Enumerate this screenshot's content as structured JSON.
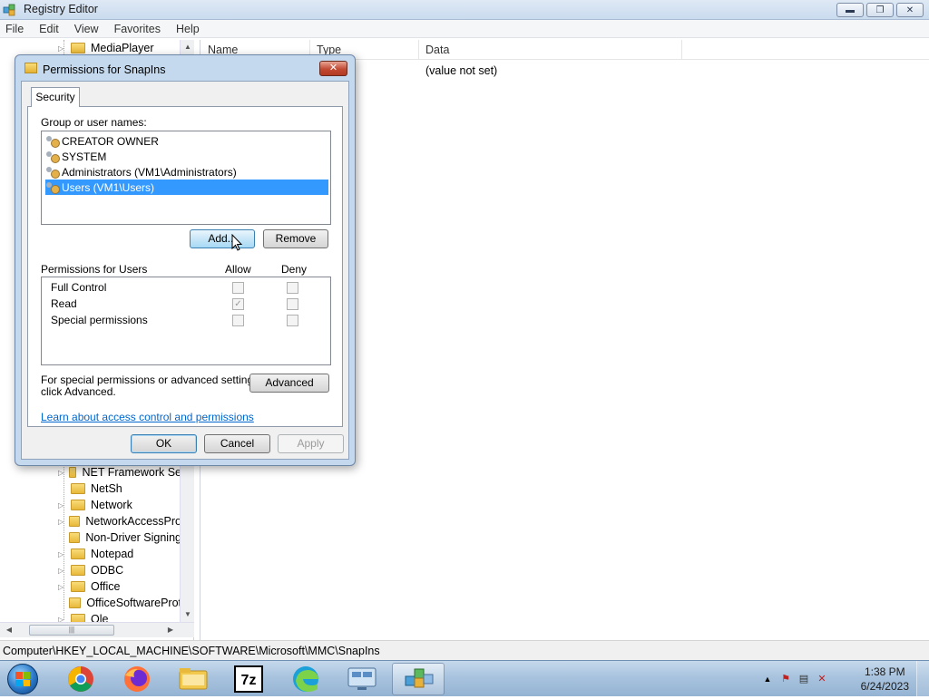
{
  "window": {
    "title": "Registry Editor",
    "controls": {
      "minimize": "▬",
      "maximize": "❐",
      "close": "✕"
    }
  },
  "menu": [
    "File",
    "Edit",
    "View",
    "Favorites",
    "Help"
  ],
  "tree": {
    "top_item": "MediaPlayer",
    "items": [
      "NET Framework Se",
      "NetSh",
      "Network",
      "NetworkAccessPro",
      "Non-Driver Signing",
      "Notepad",
      "ODBC",
      "Office",
      "OfficeSoftwareProt",
      "Ole"
    ]
  },
  "list": {
    "columns": [
      "Name",
      "Type",
      "Data"
    ],
    "row_data": "(value not set)"
  },
  "status_path": "Computer\\HKEY_LOCAL_MACHINE\\SOFTWARE\\Microsoft\\MMC\\SnapIns",
  "dialog": {
    "title": "Permissions for SnapIns",
    "close": "✕",
    "tab": "Security",
    "group_label": "Group or user names:",
    "users": [
      "CREATOR OWNER",
      "SYSTEM",
      "Administrators (VM1\\Administrators)",
      "Users (VM1\\Users)"
    ],
    "selected_user_index": 3,
    "add_button": "Add...",
    "remove_button": "Remove",
    "permissions_label": "Permissions for Users",
    "allow_header": "Allow",
    "deny_header": "Deny",
    "permissions": [
      {
        "name": "Full Control",
        "allow": false,
        "deny": false
      },
      {
        "name": "Read",
        "allow": true,
        "deny": false
      },
      {
        "name": "Special permissions",
        "allow": false,
        "deny": false
      }
    ],
    "advanced_text_1": "For special permissions or advanced settings,",
    "advanced_text_2": "click Advanced.",
    "advanced_button": "Advanced",
    "learn_link": "Learn about access control and permissions",
    "ok_button": "OK",
    "cancel_button": "Cancel",
    "apply_button": "Apply"
  },
  "taskbar": {
    "apps": [
      "chrome-icon",
      "firefox-icon",
      "file-explorer-icon",
      "7zip-icon",
      "edge-icon",
      "remote-desktop-icon",
      "registry-editor-icon"
    ],
    "sevenzip_label": "7z",
    "time": "1:38 PM",
    "date": "6/24/2023"
  }
}
